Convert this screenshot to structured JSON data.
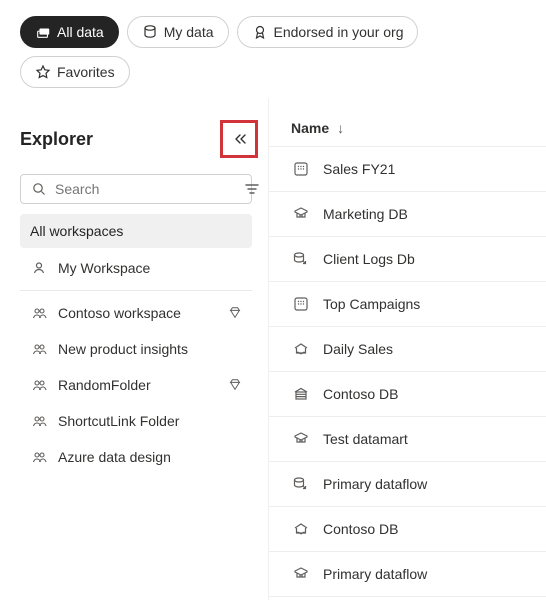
{
  "filters": {
    "all_data": "All data",
    "my_data": "My data",
    "endorsed": "Endorsed in your org",
    "favorites": "Favorites"
  },
  "sidebar": {
    "title": "Explorer",
    "search_placeholder": "Search",
    "all_workspaces": "All workspaces",
    "items": [
      {
        "label": "My Workspace",
        "icon": "person",
        "premium": false
      },
      {
        "label": "Contoso workspace",
        "icon": "group",
        "premium": true
      },
      {
        "label": "New product insights",
        "icon": "group",
        "premium": false
      },
      {
        "label": "RandomFolder",
        "icon": "group",
        "premium": true
      },
      {
        "label": "ShortcutLink Folder",
        "icon": "group",
        "premium": false
      },
      {
        "label": "Azure data design",
        "icon": "group",
        "premium": false
      }
    ]
  },
  "content": {
    "column_label": "Name",
    "rows": [
      {
        "name": "Sales FY21",
        "icon": "dataset"
      },
      {
        "name": "Marketing DB",
        "icon": "datamart"
      },
      {
        "name": "Client Logs Db",
        "icon": "dataflow"
      },
      {
        "name": "Top Campaigns",
        "icon": "dataset"
      },
      {
        "name": "Daily Sales",
        "icon": "lakehouse"
      },
      {
        "name": "Contoso DB",
        "icon": "warehouse"
      },
      {
        "name": "Test datamart",
        "icon": "datamart"
      },
      {
        "name": "Primary dataflow",
        "icon": "dataflow"
      },
      {
        "name": "Contoso DB",
        "icon": "lakehouse"
      },
      {
        "name": "Primary dataflow",
        "icon": "datamart"
      }
    ]
  }
}
